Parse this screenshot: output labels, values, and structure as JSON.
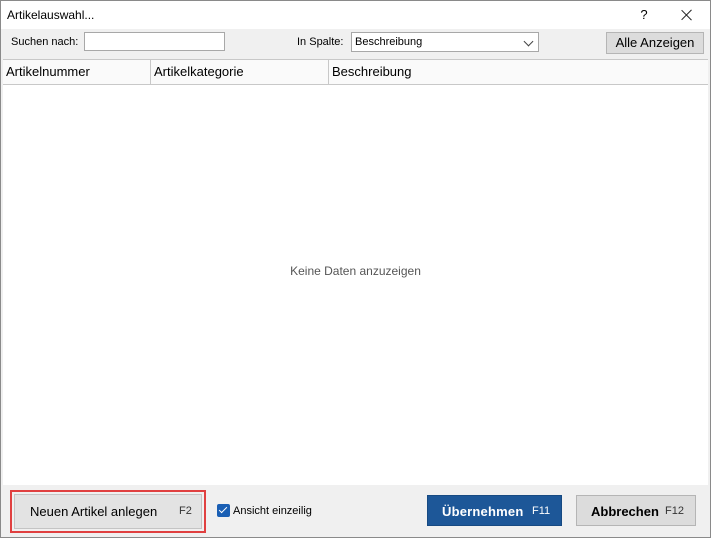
{
  "window": {
    "title": "Artikelauswahl...",
    "help_glyph": "?",
    "close_icon": "close-icon"
  },
  "toolbar": {
    "search_label": "Suchen nach:",
    "search_value": "",
    "column_label": "In Spalte:",
    "column_selected": "Beschreibung",
    "show_all_label": "Alle Anzeigen"
  },
  "grid": {
    "columns": [
      "Artikelnummer",
      "Artikelkategorie",
      "Beschreibung"
    ],
    "rows": [],
    "empty_text": "Keine Daten anzuzeigen"
  },
  "footer": {
    "new_article_label": "Neuen Artikel anlegen",
    "new_article_key": "F2",
    "single_line_label": "Ansicht einzeilig",
    "single_line_checked": true,
    "apply_label": "Übernehmen",
    "apply_key": "F11",
    "cancel_label": "Abbrechen",
    "cancel_key": "F12"
  },
  "colors": {
    "accent": "#1d5798",
    "highlight": "#e04040",
    "checkbox": "#1a5fb4"
  }
}
